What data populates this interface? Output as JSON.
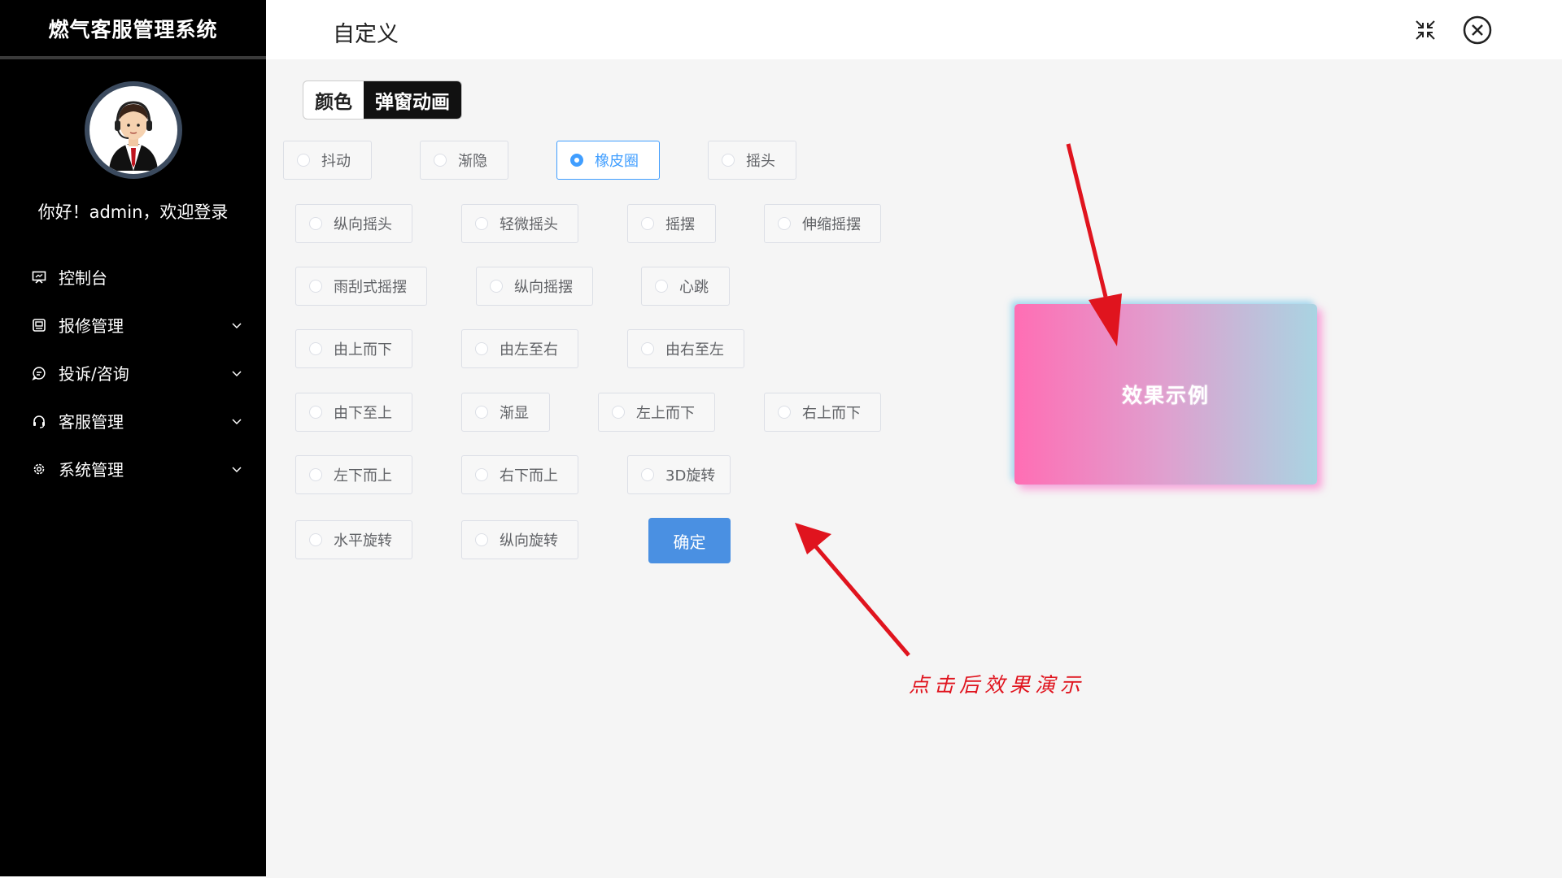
{
  "sidebar": {
    "brand": "燃气客服管理系统",
    "greeting": "你好！admin，欢迎登录",
    "items": [
      {
        "label": "控制台",
        "icon": "dashboard-icon",
        "expandable": false
      },
      {
        "label": "报修管理",
        "icon": "repair-icon",
        "expandable": true
      },
      {
        "label": "投诉/咨询",
        "icon": "chat-icon",
        "expandable": true
      },
      {
        "label": "客服管理",
        "icon": "headset-icon",
        "expandable": true
      },
      {
        "label": "系统管理",
        "icon": "gear-icon",
        "expandable": true
      }
    ]
  },
  "header": {
    "title": "自定义",
    "icons": [
      "compress-icon",
      "close-circle-icon"
    ]
  },
  "tabs": [
    {
      "label": "颜色",
      "active": false
    },
    {
      "label": "弹窗动画",
      "active": true
    }
  ],
  "animation_options": [
    {
      "label": "抖动",
      "checked": false
    },
    {
      "label": "渐隐",
      "checked": false
    },
    {
      "label": "橡皮圈",
      "checked": true
    },
    {
      "label": "摇头",
      "checked": false
    },
    {
      "label": "纵向摇头",
      "checked": false
    },
    {
      "label": "轻微摇头",
      "checked": false
    },
    {
      "label": "摇摆",
      "checked": false
    },
    {
      "label": "伸缩摇摆",
      "checked": false
    },
    {
      "label": "雨刮式摇摆",
      "checked": false
    },
    {
      "label": "纵向摇摆",
      "checked": false
    },
    {
      "label": "心跳",
      "checked": false
    },
    {
      "label": "由上而下",
      "checked": false
    },
    {
      "label": "由左至右",
      "checked": false
    },
    {
      "label": "由右至左",
      "checked": false
    },
    {
      "label": "由下至上",
      "checked": false
    },
    {
      "label": "渐显",
      "checked": false
    },
    {
      "label": "左上而下",
      "checked": false
    },
    {
      "label": "右上而下",
      "checked": false
    },
    {
      "label": "左下而上",
      "checked": false
    },
    {
      "label": "右下而上",
      "checked": false
    },
    {
      "label": "3D旋转",
      "checked": false
    },
    {
      "label": "水平旋转",
      "checked": false
    },
    {
      "label": "纵向旋转",
      "checked": false
    }
  ],
  "confirm_label": "确定",
  "demo": {
    "text": "效果示例"
  },
  "annotation": "点击后效果演示",
  "colors": {
    "accent": "#409eff",
    "confirm_bg": "#4a90e2",
    "annotation": "#e0141e",
    "sidebar_bg": "#000000"
  }
}
